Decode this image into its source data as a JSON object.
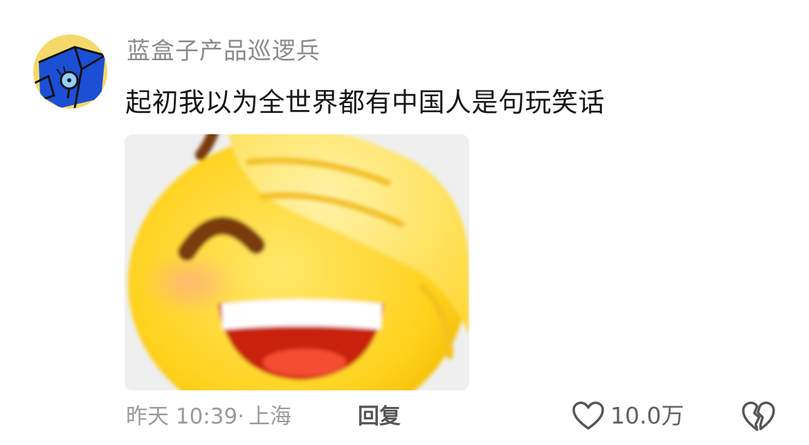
{
  "comment": {
    "username": "蓝盒子产品巡逻兵",
    "text": "起初我以为全世界都有中国人是句玩笑话",
    "timestamp": "昨天 10:39",
    "location_separator": "·",
    "location": "上海",
    "reply_label": "回复",
    "like_count": "10.0万",
    "sticker_icon": "face-palm-laughing-emoji",
    "colors": {
      "username": "#8a8a8a",
      "text": "#161616",
      "meta": "#9a9a9a",
      "action_icon": "#555555"
    }
  }
}
